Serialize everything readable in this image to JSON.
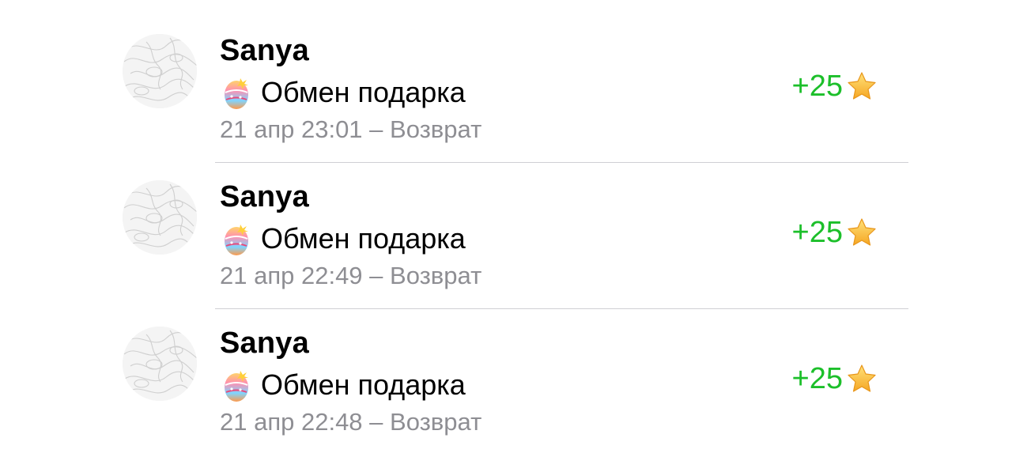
{
  "transactions": [
    {
      "name": "Sanya",
      "icon": "easter-egg-icon",
      "title": "Обмен подарка",
      "meta": "21 апр 23:01 – Возврат",
      "amount": "+25",
      "currency_icon": "star-icon"
    },
    {
      "name": "Sanya",
      "icon": "easter-egg-icon",
      "title": "Обмен подарка",
      "meta": "21 апр 22:49 – Возврат",
      "amount": "+25",
      "currency_icon": "star-icon"
    },
    {
      "name": "Sanya",
      "icon": "easter-egg-icon",
      "title": "Обмен подарка",
      "meta": "21 апр 22:48 – Возврат",
      "amount": "+25",
      "currency_icon": "star-icon"
    }
  ],
  "colors": {
    "amount_positive": "#1cbf2a",
    "meta_text": "#8e8e93",
    "divider": "#cfcfd4"
  }
}
